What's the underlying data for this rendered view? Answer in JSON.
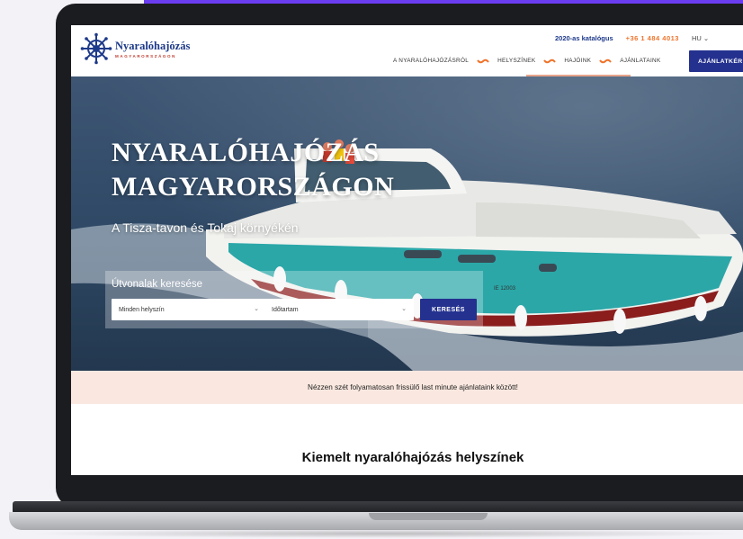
{
  "header": {
    "logo_name": "Nyaralóhajózás",
    "logo_sub": "MAGYARORSZÁGON",
    "catalog_link": "2020-as katalógus",
    "phone": "+36 1 484 4013",
    "language": "HU",
    "nav": [
      "A NYARALÓHAJÓZÁSRÓL",
      "HELYSZÍNEK",
      "HAJÓINK",
      "AJÁNLATAINK"
    ],
    "offer_button": "AJÁNLATKÉR"
  },
  "hero": {
    "title_line1": "NYARALÓHAJÓZÁS",
    "title_line2": "MAGYARORSZÁGON",
    "subtitle": "A Tisza-tavon és Tokaj környékén",
    "search": {
      "label": "Útvonalak keresése",
      "location_value": "Minden helyszín",
      "duration_value": "Időtartam",
      "button": "KERESÉS"
    },
    "boat_registration": "IE 12003"
  },
  "banner": {
    "text": "Nézzen szét folyamatosan frissülő last minute ajánlataink között!"
  },
  "featured": {
    "heading": "Kiemelt nyaralóhajózás helyszínek"
  },
  "colors": {
    "brand_blue": "#24318f",
    "accent_orange": "#f0732a",
    "banner_bg": "#fae8e0",
    "top_strip": "#6a3df0"
  }
}
